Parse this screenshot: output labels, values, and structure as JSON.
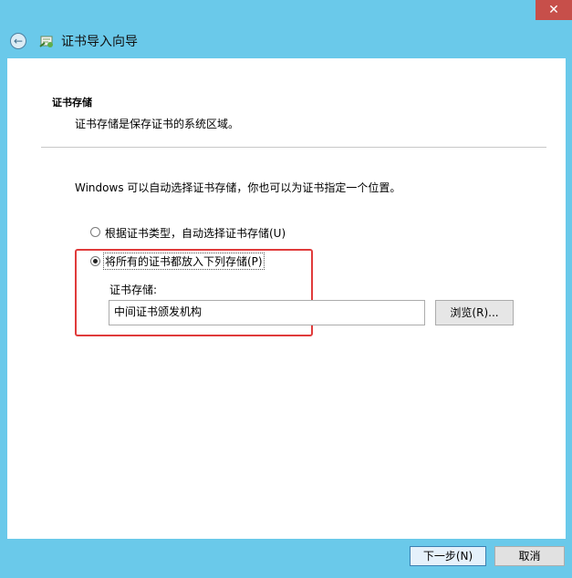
{
  "window": {
    "close_glyph": "✕",
    "title": "证书导入向导",
    "back_glyph": "←"
  },
  "section": {
    "heading": "证书存储",
    "description": "证书存储是保存证书的系统区域。"
  },
  "main": {
    "auto_text": "Windows 可以自动选择证书存储，你也可以为证书指定一个位置。",
    "option_auto": "根据证书类型，自动选择证书存储(U)",
    "option_manual": "将所有的证书都放入下列存储(P)",
    "option_selected": "manual",
    "store_label": "证书存储:",
    "store_value": "中间证书颁发机构",
    "browse_label": "浏览(R)..."
  },
  "footer": {
    "next_label": "下一步(N)",
    "cancel_label": "取消"
  },
  "colors": {
    "frame": "#6ac9ea",
    "highlight_box": "#e03b3b",
    "close_button": "#c74f4a"
  },
  "icons": {
    "back": "back-arrow-icon",
    "wizard": "certificate-wizard-icon"
  }
}
